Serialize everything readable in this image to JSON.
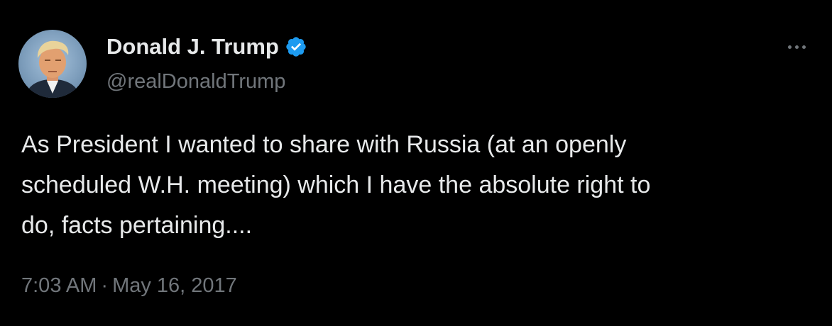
{
  "tweet": {
    "author": {
      "name": "Donald J. Trump",
      "handle": "@realDonaldTrump",
      "verified": true
    },
    "text_lines": [
      "As President I wanted to share with Russia (at an openly",
      "scheduled W.H. meeting) which I have the absolute right to",
      "do, facts pertaining...."
    ],
    "time": "7:03 AM",
    "separator": "·",
    "date": "May 16, 2017"
  },
  "colors": {
    "background": "#000000",
    "primary_text": "#e7e9ea",
    "secondary_text": "#71767b",
    "verified_badge": "#1d9bf0"
  },
  "icons": {
    "verified": "verified-badge-icon",
    "more": "more-options-icon"
  }
}
